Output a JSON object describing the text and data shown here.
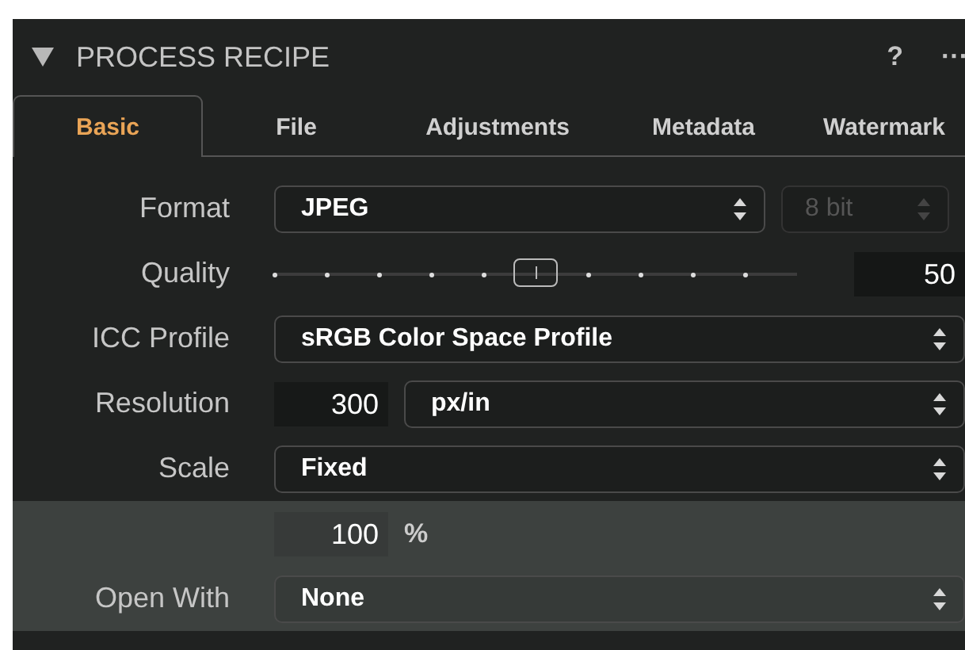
{
  "panel": {
    "title": "PROCESS RECIPE",
    "expanded": true,
    "help": "?",
    "more": "···"
  },
  "tabs": [
    {
      "label": "Basic",
      "selected": true
    },
    {
      "label": "File",
      "selected": false
    },
    {
      "label": "Adjustments",
      "selected": false
    },
    {
      "label": "Metadata",
      "selected": false
    },
    {
      "label": "Watermark",
      "selected": false
    }
  ],
  "rows": [
    {
      "kind": "popup",
      "label": "Format",
      "value": "JPEG",
      "extra": {
        "value": "8 bit",
        "disabled": true
      }
    },
    {
      "kind": "slider",
      "label": "Quality",
      "level": 0.5,
      "reading": "50"
    },
    {
      "kind": "popup",
      "label": "ICC Profile",
      "value": "sRGB Color Space Profile"
    },
    {
      "kind": "field-popup",
      "label": "Resolution",
      "field": "300",
      "value": "px/in"
    },
    {
      "kind": "popup",
      "label": "Scale",
      "value": "Fixed"
    },
    {
      "kind": "field-unit",
      "field": "100",
      "unit": "%"
    },
    {
      "kind": "popup",
      "label": "Open With",
      "value": "None"
    }
  ]
}
